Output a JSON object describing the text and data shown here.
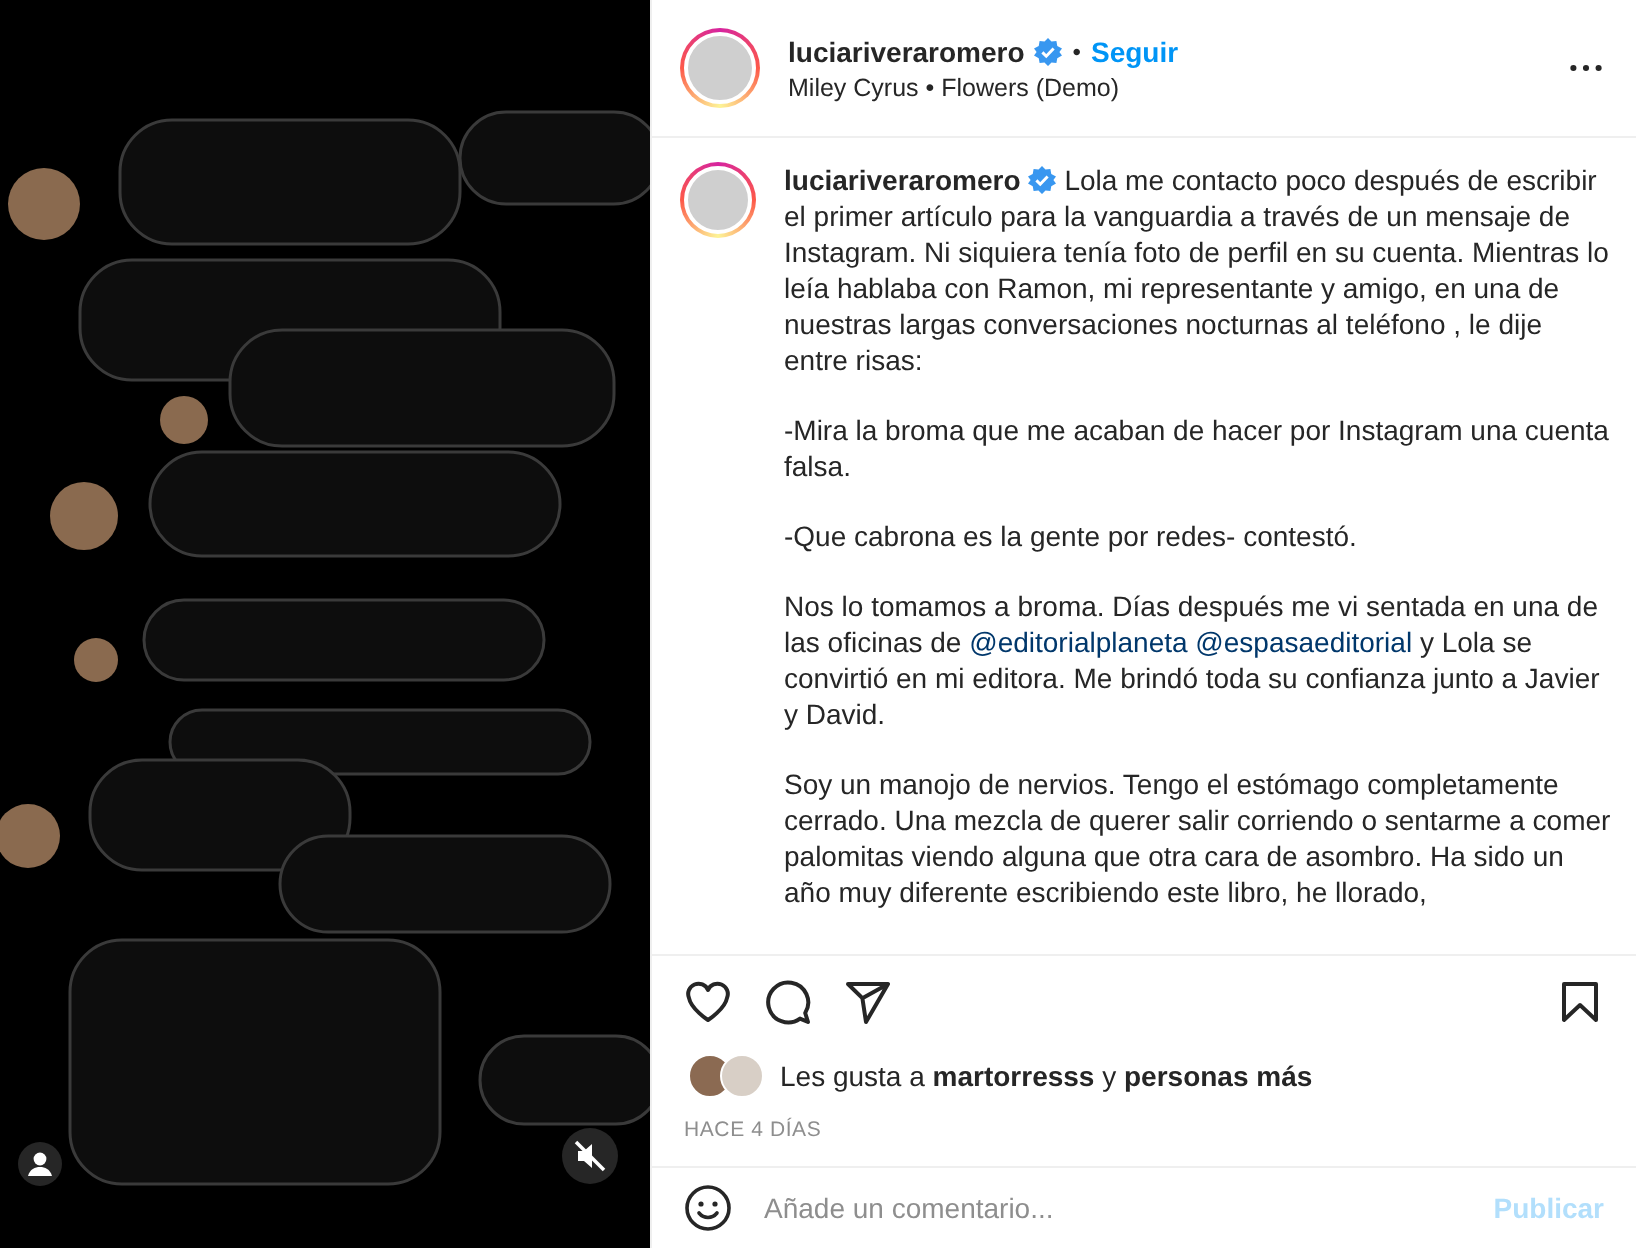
{
  "media": {
    "kind": "picture",
    "muted": true,
    "tagged": true
  },
  "header": {
    "username": "luciariveraromero",
    "verified": true,
    "separator": "•",
    "follow": "Seguir",
    "audio": "Miley Cyrus • Flowers (Demo)"
  },
  "caption": {
    "username": "luciariveraromero",
    "verified": true,
    "paragraphs": [
      [
        {
          "kind": "text",
          "text": "Lola me contacto poco después de escribir el primer artículo para la vanguardia a través de un mensaje de Instagram. Ni siquiera tenía foto de perfil en su cuenta. Mientras lo leía hablaba con Ramon, mi representante y amigo, en una de nuestras largas conversaciones nocturnas al teléfono , le dije entre risas:"
        }
      ],
      [
        {
          "kind": "text",
          "text": "-Mira la broma que me acaban de hacer por Instagram una cuenta falsa."
        }
      ],
      [
        {
          "kind": "text",
          "text": "-Que cabrona es la gente por redes- contestó."
        }
      ],
      [
        {
          "kind": "text",
          "text": "Nos lo tomamos a broma. Días después me vi sentada en una de las oficinas de "
        },
        {
          "kind": "mention",
          "text": "@editorialplaneta"
        },
        {
          "kind": "mention",
          "text": "@espasaeditorial"
        },
        {
          "kind": "text",
          "text": " y Lola se convirtió en mi editora. Me brindó toda su confianza junto a Javier y David."
        }
      ],
      [
        {
          "kind": "text",
          "text": "Soy un manojo de nervios. Tengo el estómago completamente cerrado. Una mezcla de querer salir corriendo o sentarme a comer palomitas viendo alguna que otra cara de asombro. Ha sido un año muy diferente escribiendo este libro, he llorado,"
        }
      ]
    ]
  },
  "actions": {
    "liked": false,
    "saved": false
  },
  "likes": {
    "text": "Les gusta a **martorresss** y **personas más**"
  },
  "time": "HACE 4 DÍAS",
  "comment": {
    "placeholder": "Añade un comentario...",
    "submit": "Publicar",
    "disabled": true
  }
}
